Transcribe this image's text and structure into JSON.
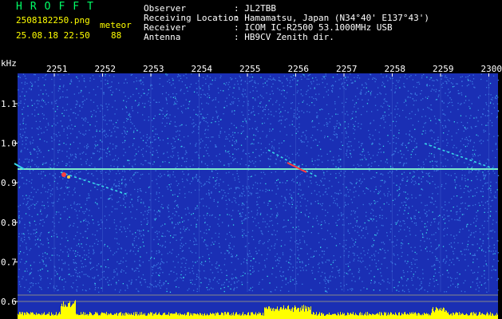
{
  "header": {
    "brand": "HROFFT",
    "filename": "2508182250.png",
    "datetime": "25.08.18 22:50",
    "mode_label": "meteor",
    "mode_count": "88",
    "observer_label": "Observer",
    "observer_value": ": JL2TBB",
    "location_label": "Receiving Location",
    "location_value": ": Hamamatsu, Japan (N34°40' E137°43')",
    "receiver_label": "Receiver",
    "receiver_value": ": ICOM IC-R2500 53.1000MHz USB",
    "antenna_label": "Antenna",
    "antenna_value": ": HB9CV Zenith dir."
  },
  "spectrogram": {
    "y_unit": "kHz",
    "y_ticks": [
      "1.1",
      "1.0",
      "0.9",
      "0.8",
      "0.7",
      "0.6"
    ],
    "y_tick_values": [
      1.1,
      1.0,
      0.9,
      0.8,
      0.7,
      0.6
    ],
    "x_ticks": [
      "2251",
      "2252",
      "2253",
      "2254",
      "2255",
      "2256",
      "2257",
      "2258",
      "2259",
      "2300"
    ],
    "colors": {
      "background": "#1a2fb4",
      "noise_light": "#3a78e0",
      "noise_cyan": "#39d8e8",
      "carrier": "#7de8c8",
      "echo_red": "#ff4040",
      "echo_yellow": "#ffd040",
      "baseline": "#ffff00"
    }
  }
}
